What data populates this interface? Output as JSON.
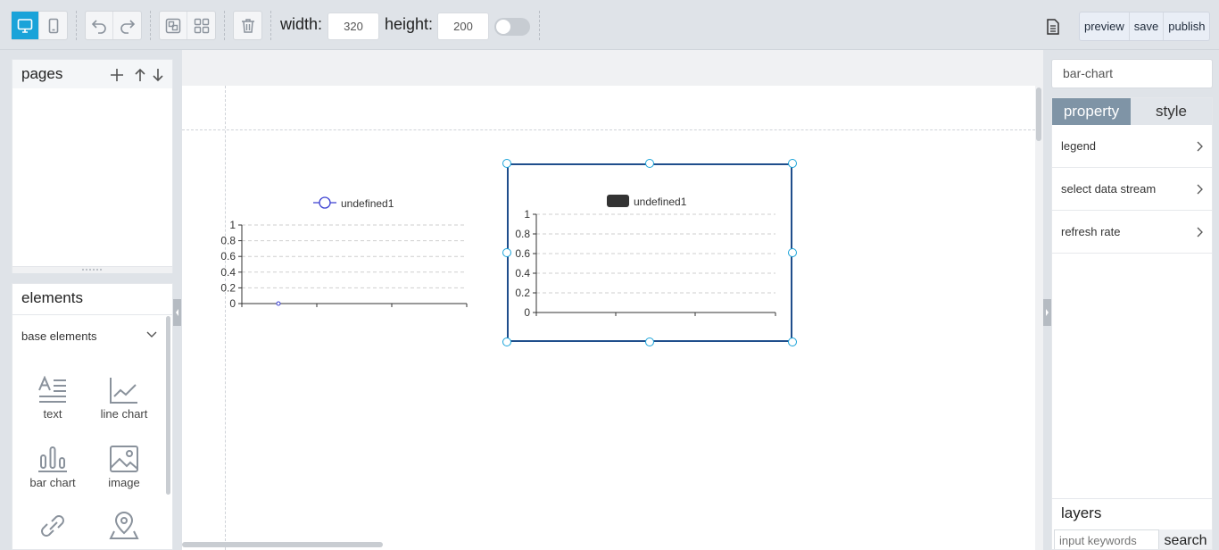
{
  "toolbar": {
    "width_label": "width:",
    "width_value": "320",
    "height_label": "height:",
    "height_value": "200",
    "actions": {
      "preview": "preview",
      "save": "save",
      "publish": "publish"
    },
    "accent": "#1aa3d9"
  },
  "pages_panel": {
    "title": "pages"
  },
  "elements_panel": {
    "title": "elements",
    "category": "base elements",
    "items": [
      {
        "label": "text",
        "icon": "text-icon"
      },
      {
        "label": "line chart",
        "icon": "line-chart-icon"
      },
      {
        "label": "bar chart",
        "icon": "bar-chart-icon"
      },
      {
        "label": "image",
        "icon": "image-icon"
      },
      {
        "label": "",
        "icon": "link-icon"
      },
      {
        "label": "",
        "icon": "map-pin-icon"
      }
    ]
  },
  "chart_data": [
    {
      "type": "line",
      "series": [
        {
          "name": "undefined1",
          "values": [
            0
          ]
        }
      ],
      "y_ticks": [
        "1",
        "0.8",
        "0.6",
        "0.4",
        "0.2",
        "0"
      ],
      "ylim": [
        0,
        1
      ],
      "grid": true,
      "legend_position": "top-center",
      "color": "#3a3fd1"
    },
    {
      "type": "bar",
      "series": [
        {
          "name": "undefined1",
          "values": []
        }
      ],
      "y_ticks": [
        "1",
        "0.8",
        "0.6",
        "0.4",
        "0.2",
        "0"
      ],
      "ylim": [
        0,
        1
      ],
      "grid": true,
      "legend_position": "top-center",
      "color": "#333333",
      "selected": true
    }
  ],
  "right_panel": {
    "selected_name": "bar-chart",
    "tabs": {
      "property": "property",
      "style": "style"
    },
    "rows": [
      "legend",
      "select data stream",
      "refresh rate"
    ]
  },
  "layers_panel": {
    "title": "layers",
    "placeholder": "input keywords",
    "search_label": "search"
  }
}
